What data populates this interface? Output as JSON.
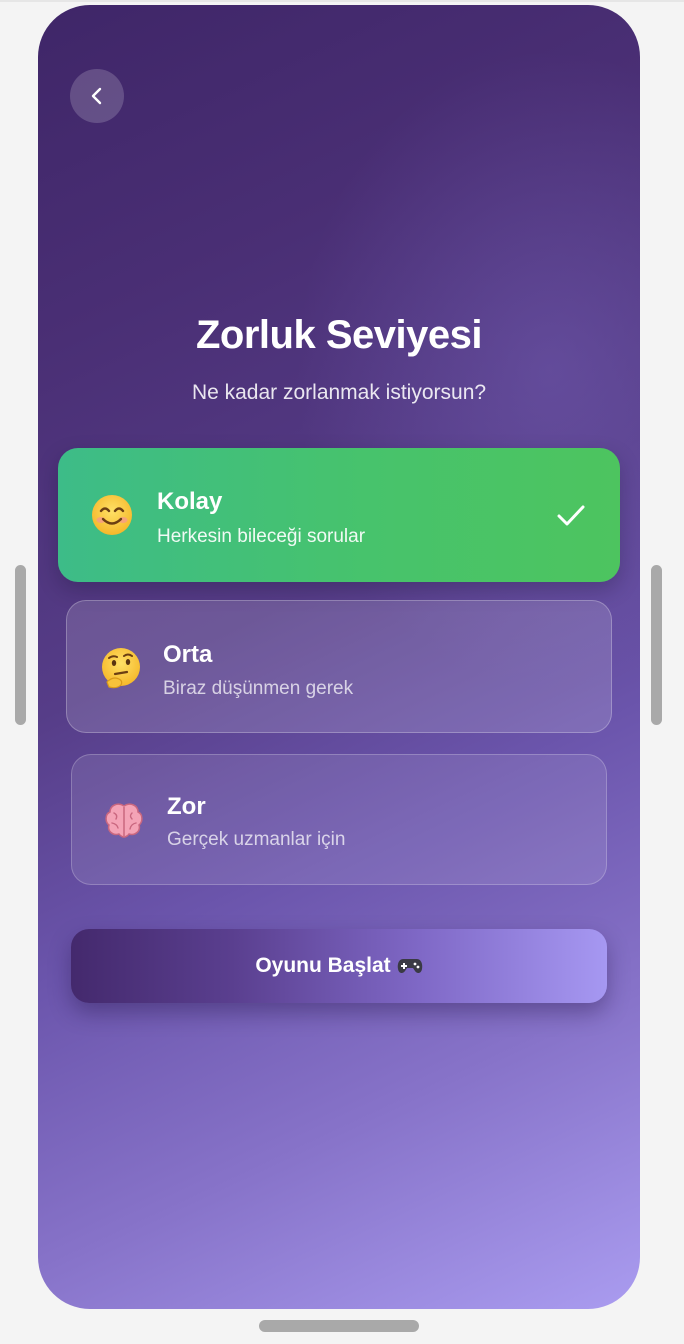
{
  "screen": {
    "title": "Zorluk Seviyesi",
    "subtitle": "Ne kadar zorlanmak istiyorsun?"
  },
  "options": [
    {
      "title": "Kolay",
      "description": "Herkesin bileceği sorular",
      "icon": "smiling-face-icon",
      "selected": true
    },
    {
      "title": "Orta",
      "description": "Biraz düşünmen gerek",
      "icon": "thinking-face-icon",
      "selected": false
    },
    {
      "title": "Zor",
      "description": "Gerçek uzmanlar için",
      "icon": "brain-icon",
      "selected": false
    }
  ],
  "start_button": {
    "label": "Oyunu Başlat",
    "icon": "game-controller-icon"
  },
  "navigation": {
    "back_icon": "chevron-left-icon"
  },
  "colors": {
    "selected_option": "#47c36c",
    "background_dark": "#3f2668",
    "background_light": "#aa9cf0"
  }
}
